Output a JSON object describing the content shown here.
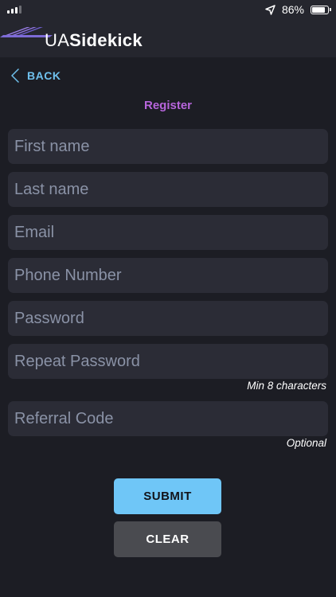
{
  "status_bar": {
    "battery_text": "86%",
    "battery_level": 0.86
  },
  "header": {
    "brand_ua": "UA",
    "brand_sidekick": "Sidekick"
  },
  "nav": {
    "back_label": "BACK"
  },
  "page": {
    "title": "Register"
  },
  "form": {
    "fields": [
      {
        "placeholder": "First name",
        "value": ""
      },
      {
        "placeholder": "Last name",
        "value": ""
      },
      {
        "placeholder": "Email",
        "value": ""
      },
      {
        "placeholder": "Phone Number",
        "value": ""
      },
      {
        "placeholder": "Password",
        "value": ""
      },
      {
        "placeholder": "Repeat Password",
        "value": ""
      },
      {
        "placeholder": "Referral Code",
        "value": ""
      }
    ],
    "password_hint": "Min 8 characters",
    "referral_hint": "Optional"
  },
  "buttons": {
    "submit_label": "SUBMIT",
    "clear_label": "CLEAR"
  },
  "colors": {
    "background": "#1c1d24",
    "header": "#25262e",
    "field": "#2b2c36",
    "accent_blue": "#6fc6f7",
    "accent_purple": "#b765dc",
    "clear_button": "#4a4b50"
  }
}
